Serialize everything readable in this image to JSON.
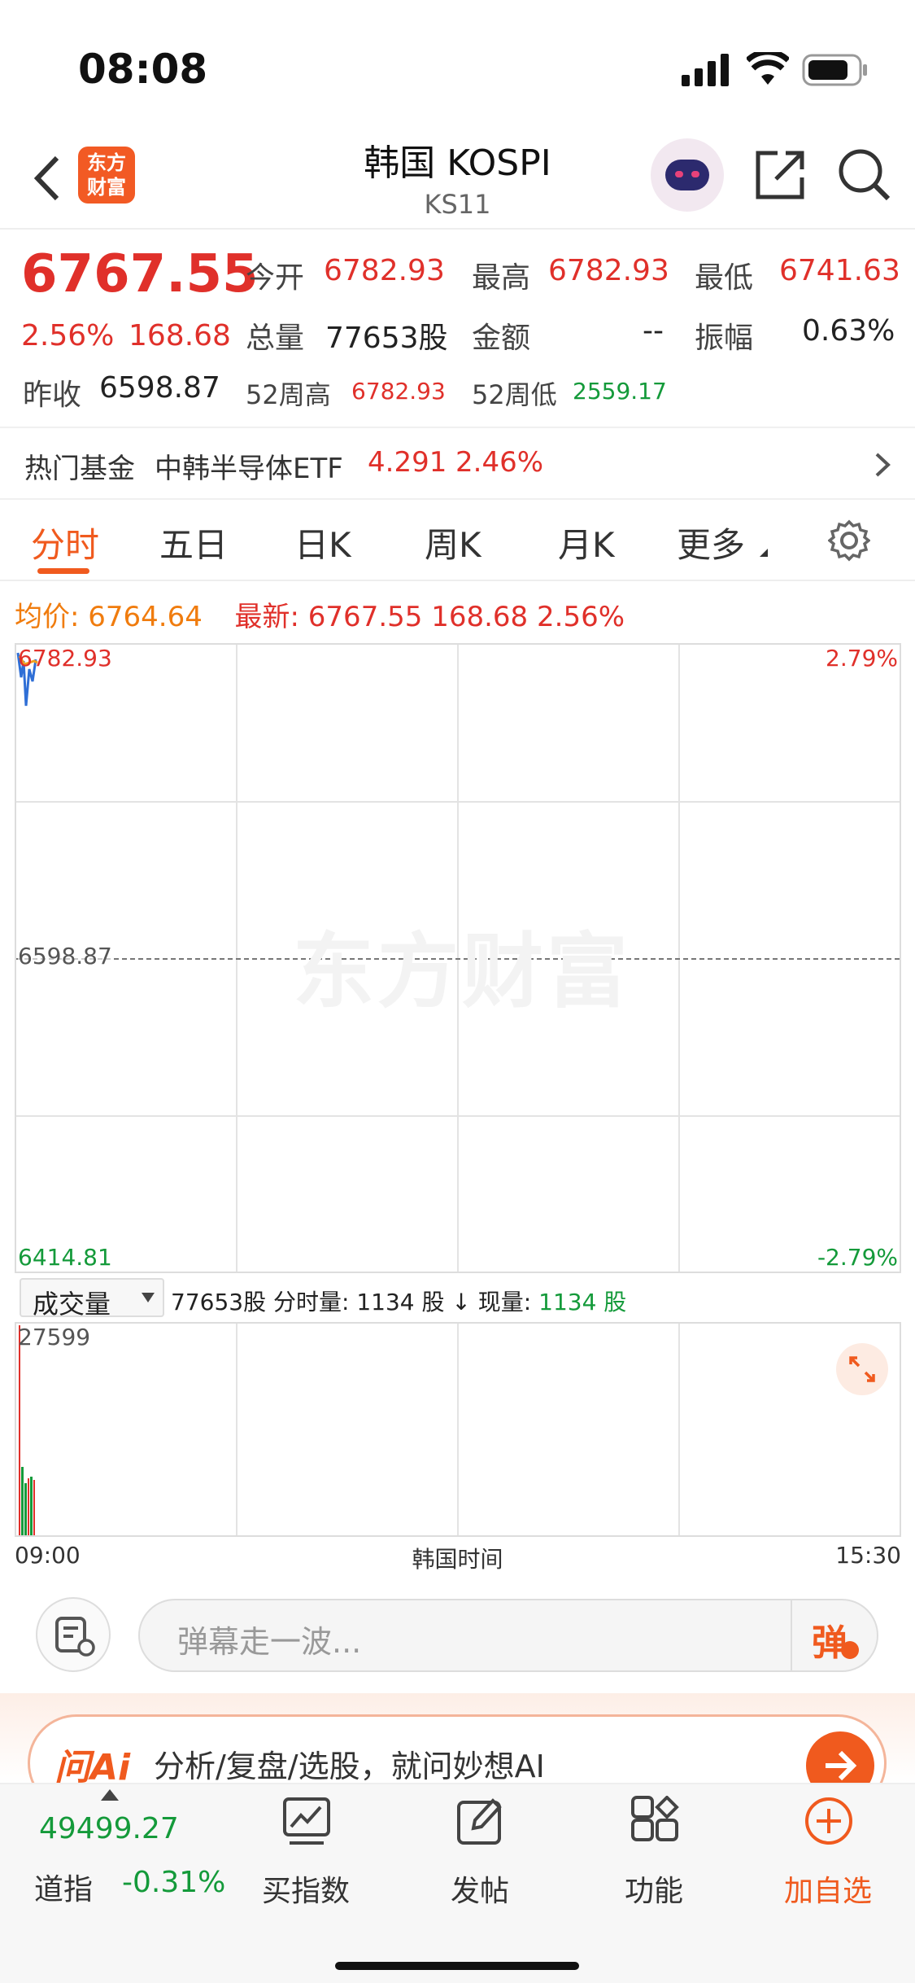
{
  "status": {
    "time": "08:08"
  },
  "header": {
    "logo": "东方财富",
    "title": "韩国 KOSPI",
    "subtitle": "KS11"
  },
  "quote": {
    "price": "6767.55",
    "pct": "2.56%",
    "chg": "168.68",
    "open_label": "今开",
    "open": "6782.93",
    "high_label": "最高",
    "high": "6782.93",
    "low_label": "最低",
    "low": "6741.63",
    "vol_label": "总量",
    "vol": "77653股",
    "amount_label": "金额",
    "amount": "--",
    "amp_label": "振幅",
    "amp": "0.63%",
    "prev_label": "昨收",
    "prev": "6598.87",
    "w52h_label": "52周高",
    "w52h": "6782.93",
    "w52l_label": "52周低",
    "w52l": "2559.17"
  },
  "fund": {
    "label": "热门基金",
    "name": "中韩半导体ETF",
    "price": "4.291",
    "pct": "2.46%"
  },
  "tabs": [
    "分时",
    "五日",
    "日K",
    "周K",
    "月K",
    "更多"
  ],
  "info": {
    "avg_label": "均价:",
    "avg": "6764.64",
    "latest_label": "最新:",
    "latest": "6767.55",
    "chg": "168.68",
    "pct": "2.56%"
  },
  "chart": {
    "top": "6782.93",
    "top_pct": "2.79%",
    "mid": "6598.87",
    "bottom": "6414.81",
    "bottom_pct": "-2.79%",
    "watermark": "东方财富"
  },
  "volume": {
    "select": "成交量",
    "total": "77653股",
    "tick_label": "分时量:",
    "tick": "1134 股",
    "now_label": "现量:",
    "now": "1134 股",
    "max": "27599",
    "x_start": "09:00",
    "x_mid": "韩国时间",
    "x_end": "15:30"
  },
  "danmu": {
    "placeholder": "弹幕走一波...",
    "btn": "弹"
  },
  "ai": {
    "logo": "问Ai",
    "text": "分析/复盘/选股，就问妙想AI"
  },
  "nav": {
    "index_value": "49499.27",
    "index_name": "道指",
    "index_pct": "-0.31%",
    "items": [
      "买指数",
      "发帖",
      "功能",
      "加自选"
    ]
  }
}
